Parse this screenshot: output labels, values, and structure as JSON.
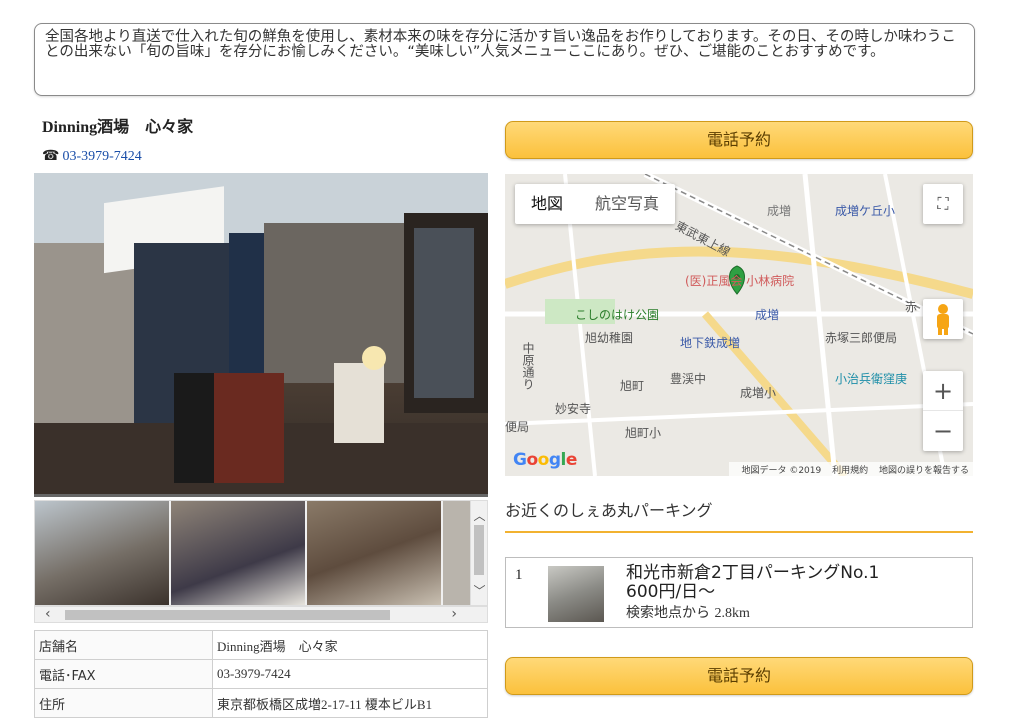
{
  "intro": {
    "text": "全国各地より直送で仕入れた旬の鮮魚を使用し、素材本来の味を存分に活かす旨い逸品をお作りしております。その日、その時しか味わうことの出来ない「旬の旨味」を存分にお愉しみください。“美味しい”人気メニューここにあり。ぜひ、ご堪能のことおすすめです。"
  },
  "shop": {
    "name": "Dinning酒場　心々家",
    "phone_icon": "☎",
    "phone": "03-3979-7424"
  },
  "call_button": {
    "label": "電話予約"
  },
  "map": {
    "tabs": [
      "地図",
      "航空写真"
    ],
    "fullscreen_icon": "⛶",
    "zoom_in": "+",
    "zoom_out": "−",
    "pegman_icon": "pegman-icon",
    "google": "Google",
    "footer": [
      "地図データ ©2019",
      "利用規約",
      "地図の誤りを報告する"
    ],
    "labels": [
      "成増",
      "成増ケ丘小",
      "東武東上線",
      "(医)正風会 小林病院",
      "こしのはけ公園",
      "成増",
      "旭幼稚園",
      "地下鉄成増",
      "赤塚三郎便局",
      "小治兵衛窪庚",
      "豊渓中",
      "旭町",
      "成増小",
      "妙安寺",
      "旭町小",
      "便局",
      "中原通り",
      "赤"
    ]
  },
  "parking": {
    "heading": "お近くのしぇあ丸パーキング",
    "items": [
      {
        "num": "1",
        "name": "和光市新倉2丁目パーキングNo.1",
        "price": "600円/日〜",
        "dist_prefix": "検索地点から",
        "dist": "2.8km"
      }
    ]
  },
  "table": {
    "rows": [
      {
        "key": "店舗名",
        "val": "Dinning酒場　心々家"
      },
      {
        "key": "電話･FAX",
        "val": "03-3979-7424"
      },
      {
        "key": "住所",
        "val": "東京都板橋区成増2-17-11 榎本ビルB1"
      }
    ]
  },
  "colors": {
    "button_top": "#ffd978",
    "button_bottom": "#fbc13c",
    "link": "#1a4ea8",
    "accent_rule": "#f2b230",
    "map_pin": "#2fa043"
  }
}
